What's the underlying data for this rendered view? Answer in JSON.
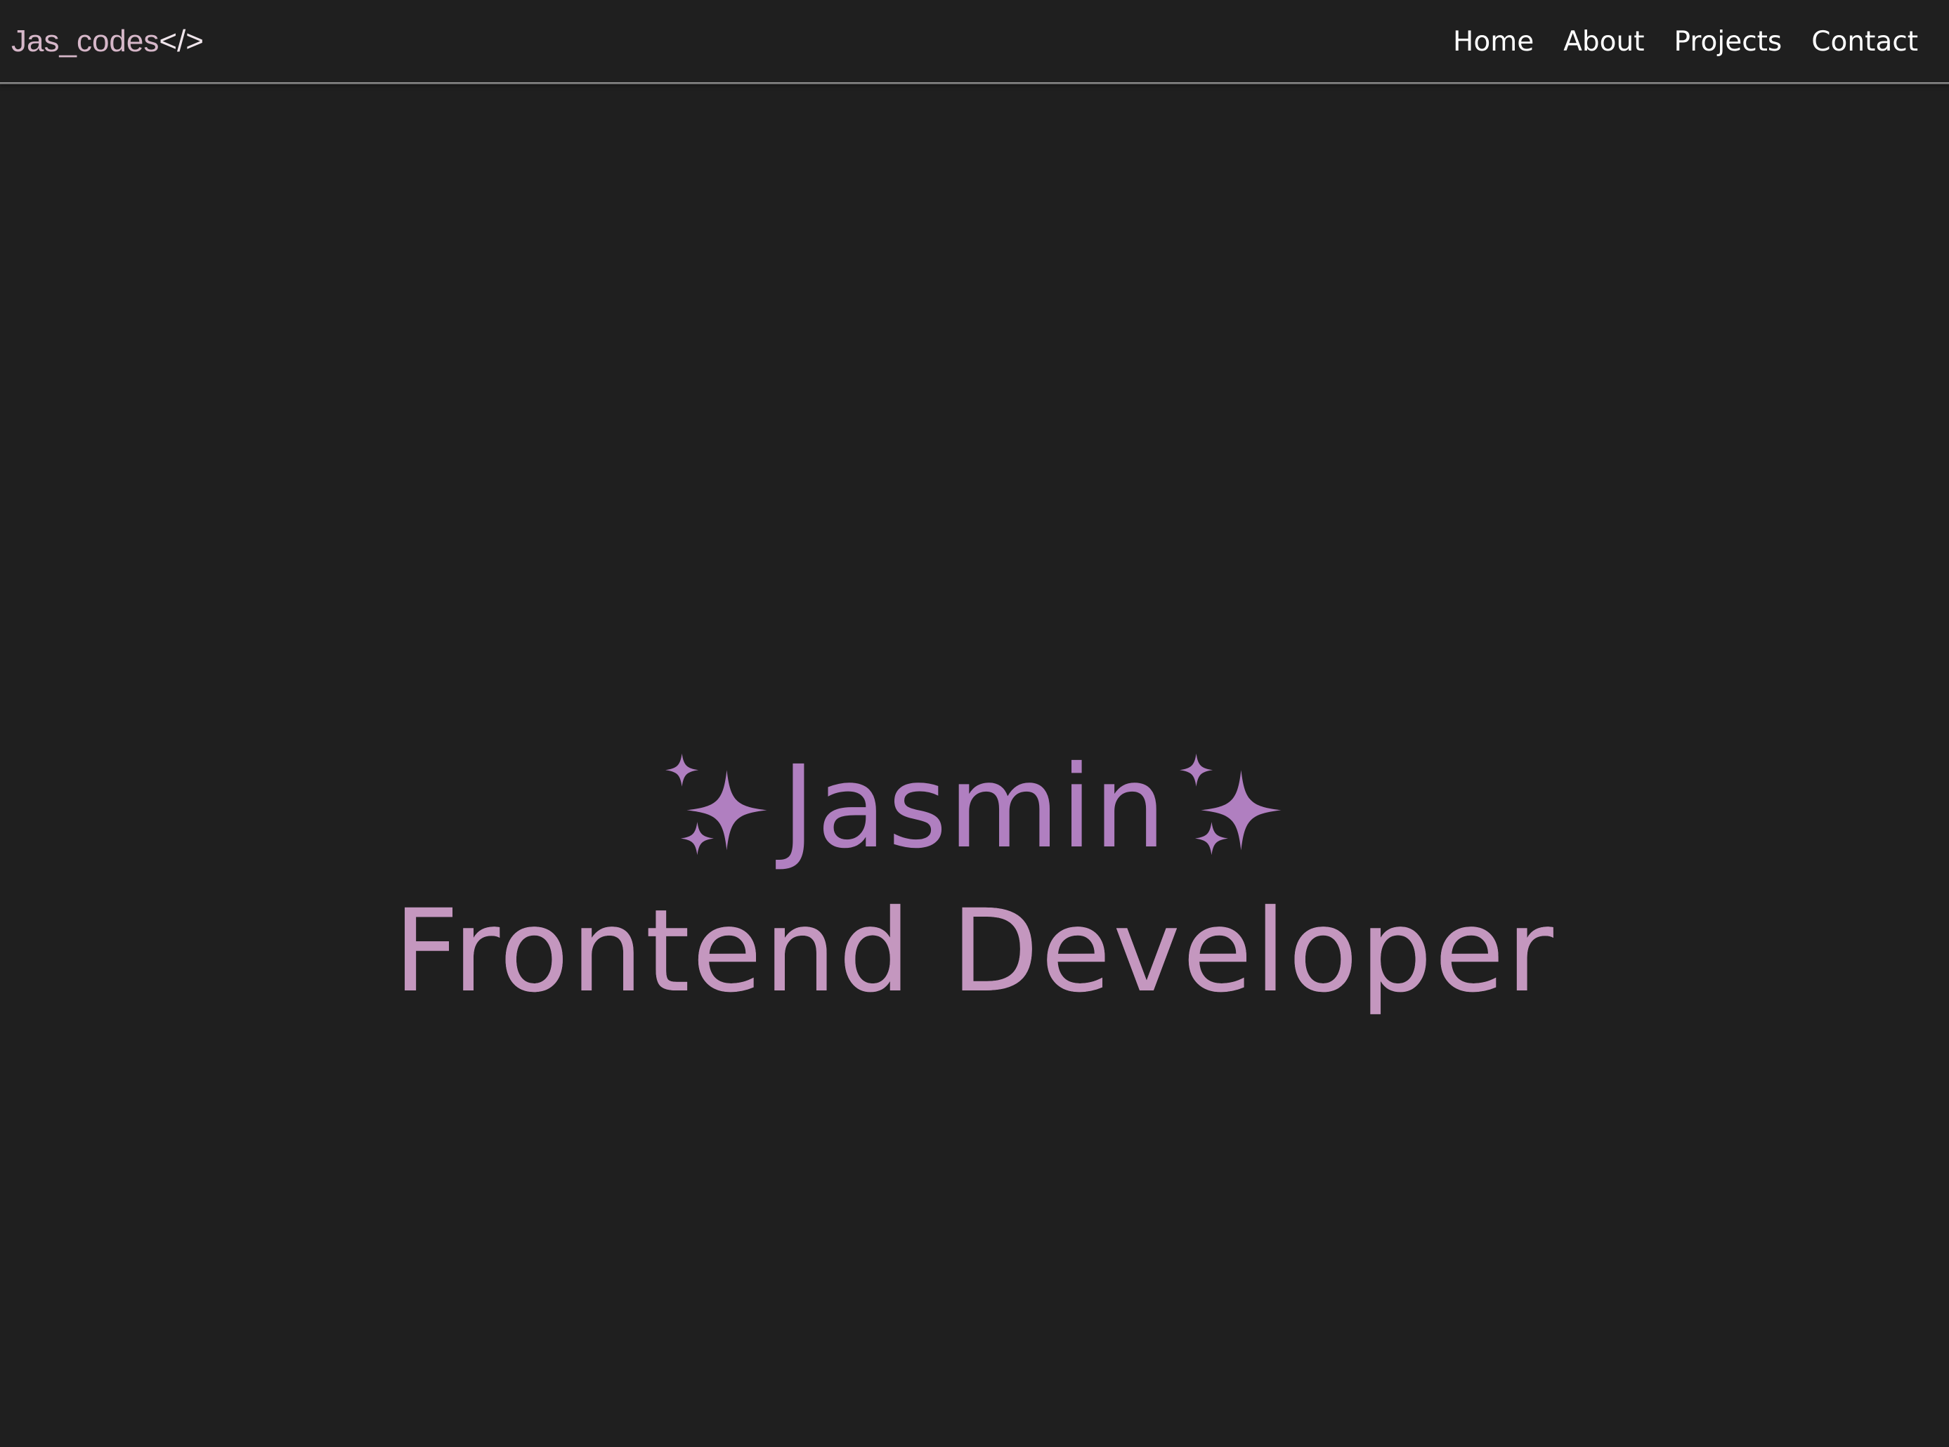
{
  "header": {
    "logo": {
      "name": "Jas_codes",
      "tag": "</>"
    },
    "nav": [
      {
        "label": "Home"
      },
      {
        "label": "About"
      },
      {
        "label": "Projects"
      },
      {
        "label": "Contact"
      }
    ]
  },
  "hero": {
    "name": "Jasmin",
    "title": "Frontend Developer",
    "icons": [
      "sparkles-icon",
      "sparkles-icon"
    ]
  },
  "colors": {
    "background": "#1f1f1f",
    "logo_name": "#d6b7c9",
    "accent": "#b07fc0",
    "title": "#c497bf",
    "nav_text": "#ffffff"
  }
}
